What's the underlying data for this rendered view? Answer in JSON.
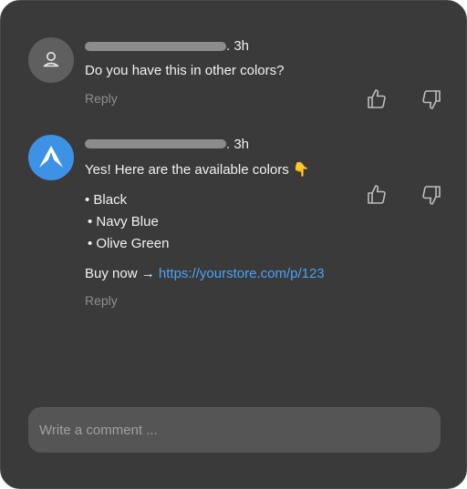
{
  "comments": [
    {
      "time": ". 3h",
      "text": "Do you have this in other colors?",
      "reply_label": "Reply",
      "avatar_icon": "user-icon"
    },
    {
      "time": ". 3h",
      "intro": "Yes! Here are the available colors",
      "intro_emoji": "👇",
      "colors": [
        "• Black",
        "• Navy Blue",
        "• Olive Green"
      ],
      "buy_label": "Buy now",
      "arrow": "→",
      "link": "https://yourstore.com/p/123",
      "reply_label": "Reply",
      "avatar_icon": "brand-logo-icon",
      "accent": "#3e92e6"
    }
  ],
  "composer": {
    "placeholder": "Write a comment ..."
  },
  "icons": {
    "like": "thumbs-up-icon",
    "dislike": "thumbs-down-icon"
  }
}
